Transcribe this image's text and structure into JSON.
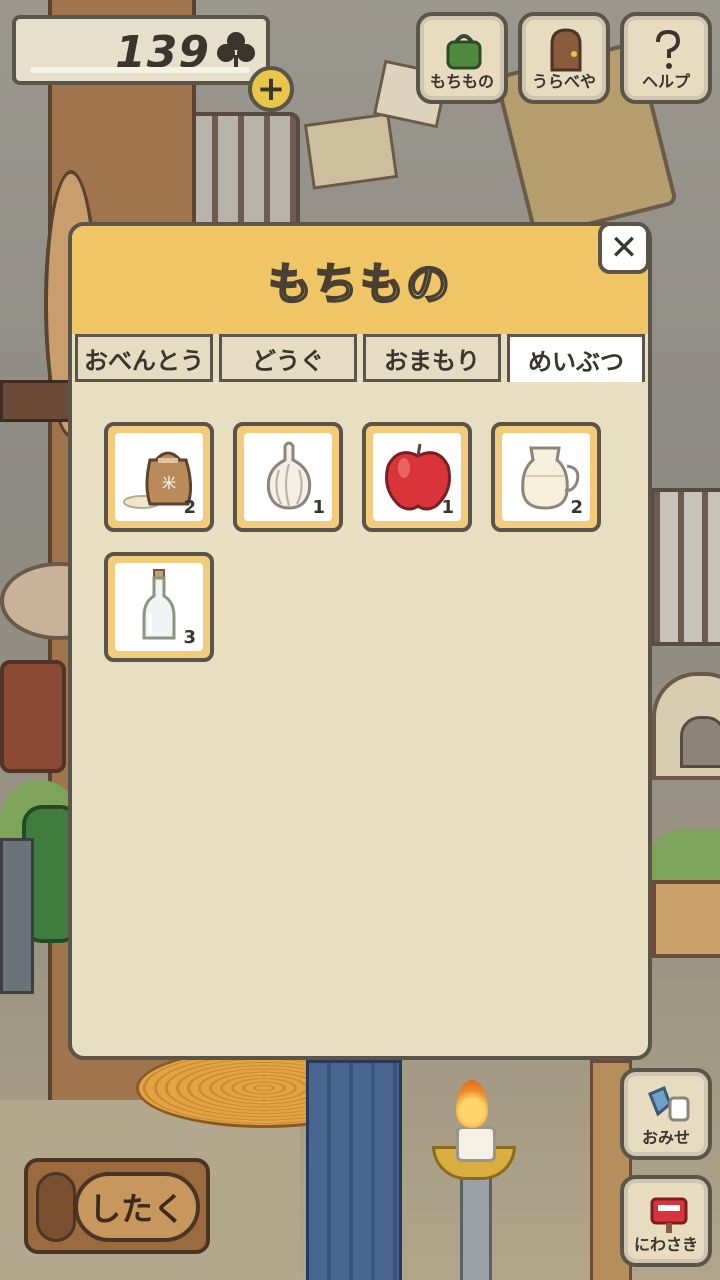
{
  "hud": {
    "clover_count": "139",
    "plus_label": "+"
  },
  "top_menu": [
    {
      "label": "もちもの",
      "icon": "bag-icon"
    },
    {
      "label": "うらべや",
      "icon": "door-icon"
    },
    {
      "label": "ヘルプ",
      "icon": "question-icon"
    }
  ],
  "side_menu": [
    {
      "label": "おみせ",
      "icon": "shop-bags-icon"
    },
    {
      "label": "にわさき",
      "icon": "mailbox-icon"
    }
  ],
  "prepare_button": {
    "label": "したく"
  },
  "inventory": {
    "title": "もちもの",
    "close_label": "✕",
    "tabs": [
      {
        "label": "おべんとう",
        "active": false
      },
      {
        "label": "どうぐ",
        "active": false
      },
      {
        "label": "おまもり",
        "active": false
      },
      {
        "label": "めいぶつ",
        "active": true
      }
    ],
    "items": [
      {
        "icon": "rice-sack-icon",
        "count": "2"
      },
      {
        "icon": "garlic-icon",
        "count": "1"
      },
      {
        "icon": "apple-icon",
        "count": "1"
      },
      {
        "icon": "milk-jug-icon",
        "count": "2"
      },
      {
        "icon": "glass-bottle-icon",
        "count": "3"
      }
    ]
  },
  "colors": {
    "panel_header": "#f0c566",
    "panel_body": "#e8dfc3",
    "slot_frame": "#f2cc7c",
    "outline": "#5b5448"
  }
}
